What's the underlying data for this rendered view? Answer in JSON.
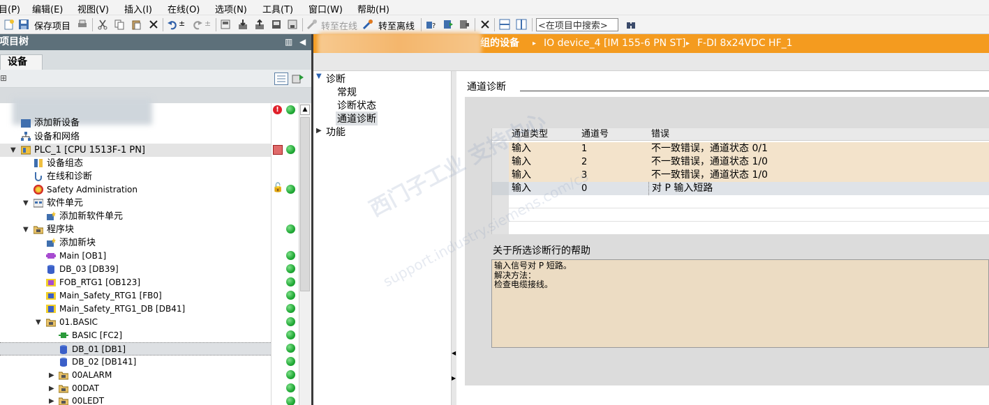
{
  "menubar": {
    "items": [
      "目(P)",
      "编辑(E)",
      "视图(V)",
      "插入(I)",
      "在线(O)",
      "选项(N)",
      "工具(T)",
      "窗口(W)",
      "帮助(H)"
    ]
  },
  "toolbar": {
    "save_label": "保存项目",
    "go_online_label": "转至在线",
    "go_offline_label": "转至离线",
    "search_placeholder": "<在项目中搜索>"
  },
  "project_tree": {
    "title": "项目树",
    "tab_label": "设备",
    "items": [
      {
        "label": "添加新设备",
        "level": 2
      },
      {
        "label": "设备和网络",
        "level": 2
      },
      {
        "label": "PLC_1 [CPU 1513F-1 PN]",
        "level": 1
      },
      {
        "label": "设备组态",
        "level": 3
      },
      {
        "label": "在线和诊断",
        "level": 3
      },
      {
        "label": "Safety Administration",
        "level": 3
      },
      {
        "label": "软件单元",
        "level": 3
      },
      {
        "label": "添加新软件单元",
        "level": 4
      },
      {
        "label": "程序块",
        "level": 3
      },
      {
        "label": "添加新块",
        "level": 4
      },
      {
        "label": "Main [OB1]",
        "level": 4
      },
      {
        "label": "DB_03 [DB39]",
        "level": 4
      },
      {
        "label": "FOB_RTG1 [OB123]",
        "level": 4
      },
      {
        "label": "Main_Safety_RTG1 [FB0]",
        "level": 4
      },
      {
        "label": "Main_Safety_RTG1_DB [DB41]",
        "level": 4
      },
      {
        "label": "01.BASIC",
        "level": 4
      },
      {
        "label": "BASIC [FC2]",
        "level": 5
      },
      {
        "label": "DB_01 [DB1]",
        "level": 5
      },
      {
        "label": "DB_02 [DB141]",
        "level": 5
      },
      {
        "label": "00ALARM",
        "level": 5
      },
      {
        "label": "00DAT",
        "level": 5
      },
      {
        "label": "00LEDT",
        "level": 5
      }
    ]
  },
  "breadcrumb": {
    "part1": "组的设备",
    "part2": "IO device_4 [IM 155-6 PN ST]",
    "part3": "F-DI 8x24VDC HF_1"
  },
  "nav": {
    "diag": "诊断",
    "general": "常规",
    "diag_status": "诊断状态",
    "channel_diag": "通道诊断",
    "function": "功能"
  },
  "channel_diag": {
    "title": "通道诊断",
    "columns": [
      "通道类型",
      "通道号",
      "错误"
    ],
    "rows": [
      {
        "type": "输入",
        "channel": "1",
        "error": "不一致错误，通道状态 0/1"
      },
      {
        "type": "输入",
        "channel": "2",
        "error": "不一致错误，通道状态 1/0"
      },
      {
        "type": "输入",
        "channel": "3",
        "error": "不一致错误，通道状态 1/0"
      },
      {
        "type": "输入",
        "channel": "0",
        "error": "对 P 输入短路"
      }
    ],
    "help_title": "关于所选诊断行的帮助",
    "help_lines": [
      "输入信号对 P 短路。",
      "解决方法：",
      "检查电缆接线。"
    ]
  },
  "watermark": {
    "line1": "西门子工业 支持中心",
    "line2": "support.industry.siemens.com/cs"
  },
  "colors": {
    "orange_header": "#f49b1f",
    "tree_header": "#5d707a",
    "row_highlight": "#f3e3cb",
    "status_ok": "#1fa834",
    "status_error": "#e0202a"
  }
}
